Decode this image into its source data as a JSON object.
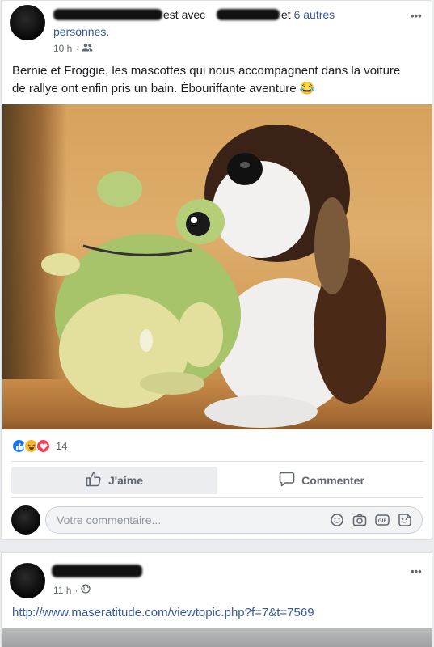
{
  "post1": {
    "header": {
      "with_text": "est avec",
      "and_text": "et",
      "others_link": "6 autres",
      "people_link": "personnes.",
      "time": "10 h",
      "separator": "·",
      "audience_icon": "friends-icon"
    },
    "text": "Bernie et Froggie, les mascottes qui nous accompagnent dans la voiture de rallye ont enfin pris un bain. Ébouriffante aventure 😂",
    "reactions": {
      "icons": [
        "like-reaction-icon",
        "haha-reaction-icon",
        "love-reaction-icon"
      ],
      "count": "14"
    },
    "actions": {
      "like_label": "J'aime",
      "comment_label": "Commenter"
    },
    "comment_box": {
      "placeholder": "Votre commentaire...",
      "icons": [
        "emoji-icon",
        "camera-icon",
        "gif-icon",
        "sticker-icon"
      ]
    },
    "menu_label": "•••"
  },
  "post2": {
    "header": {
      "time": "11 h",
      "separator": "·",
      "audience_icon": "globe-icon"
    },
    "link": "http://www.maseratitude.com/viewtopic.php?f=7&t=7569",
    "menu_label": "•••"
  },
  "colors": {
    "link_blue": "#385898",
    "like_blue": "#1877f2",
    "love_red": "#f33e58",
    "haha_yellow": "#f7b928",
    "background": "#e9ebee"
  }
}
